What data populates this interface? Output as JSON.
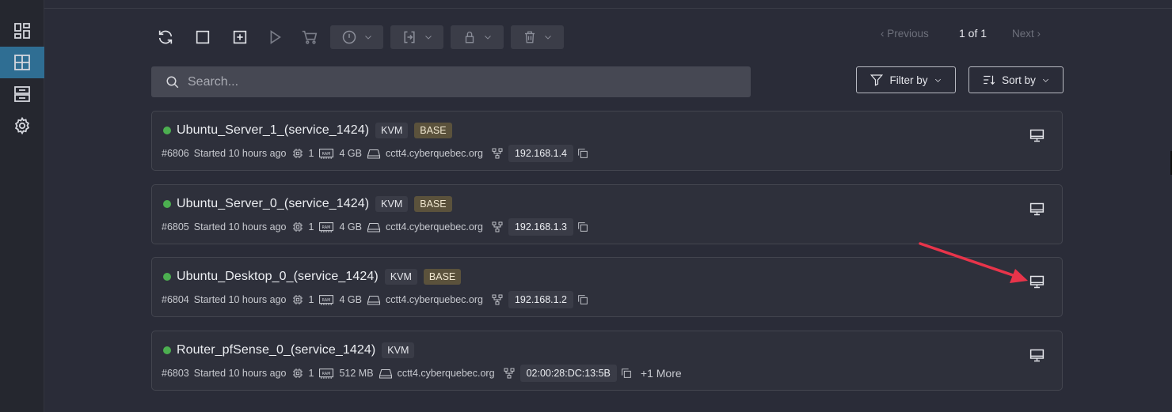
{
  "sidebar": {
    "items": [
      {
        "icon": "dashboard-icon",
        "active": false
      },
      {
        "icon": "grid-icon",
        "active": true
      },
      {
        "icon": "archive-icon",
        "active": false
      },
      {
        "icon": "gear-icon",
        "active": false
      }
    ]
  },
  "toolbar": {
    "icons": [
      "refresh-icon",
      "select-all-icon",
      "add-icon",
      "play-icon",
      "cart-icon"
    ],
    "dropdowns": [
      "power-icon",
      "login-icon",
      "lock-icon",
      "trash-icon"
    ]
  },
  "pager": {
    "previous": "Previous",
    "count": "1 of 1",
    "next": "Next"
  },
  "search": {
    "placeholder": "Search..."
  },
  "filter": {
    "label": "Filter by"
  },
  "sort": {
    "label": "Sort by"
  },
  "vms": [
    {
      "name": "Ubuntu_Server_1_(service_1424)",
      "hypervisor": "KVM",
      "tag": "BASE",
      "id": "#6806",
      "started": "Started 10 hours ago",
      "cpu": "1",
      "ram": "4 GB",
      "host": "cctt4.cyberquebec.org",
      "ip": "192.168.1.4",
      "more": ""
    },
    {
      "name": "Ubuntu_Server_0_(service_1424)",
      "hypervisor": "KVM",
      "tag": "BASE",
      "id": "#6805",
      "started": "Started 10 hours ago",
      "cpu": "1",
      "ram": "4 GB",
      "host": "cctt4.cyberquebec.org",
      "ip": "192.168.1.3",
      "more": ""
    },
    {
      "name": "Ubuntu_Desktop_0_(service_1424)",
      "hypervisor": "KVM",
      "tag": "BASE",
      "id": "#6804",
      "started": "Started 10 hours ago",
      "cpu": "1",
      "ram": "4 GB",
      "host": "cctt4.cyberquebec.org",
      "ip": "192.168.1.2",
      "more": ""
    },
    {
      "name": "Router_pfSense_0_(service_1424)",
      "hypervisor": "KVM",
      "tag": "",
      "id": "#6803",
      "started": "Started 10 hours ago",
      "cpu": "1",
      "ram": "512 MB",
      "host": "cctt4.cyberquebec.org",
      "ip": "02:00:28:DC:13:5B",
      "more": "+1 More"
    }
  ],
  "colors": {
    "accent": "#2f6e93",
    "status_running": "#4caf50",
    "annotation_arrow": "#e8344a"
  }
}
